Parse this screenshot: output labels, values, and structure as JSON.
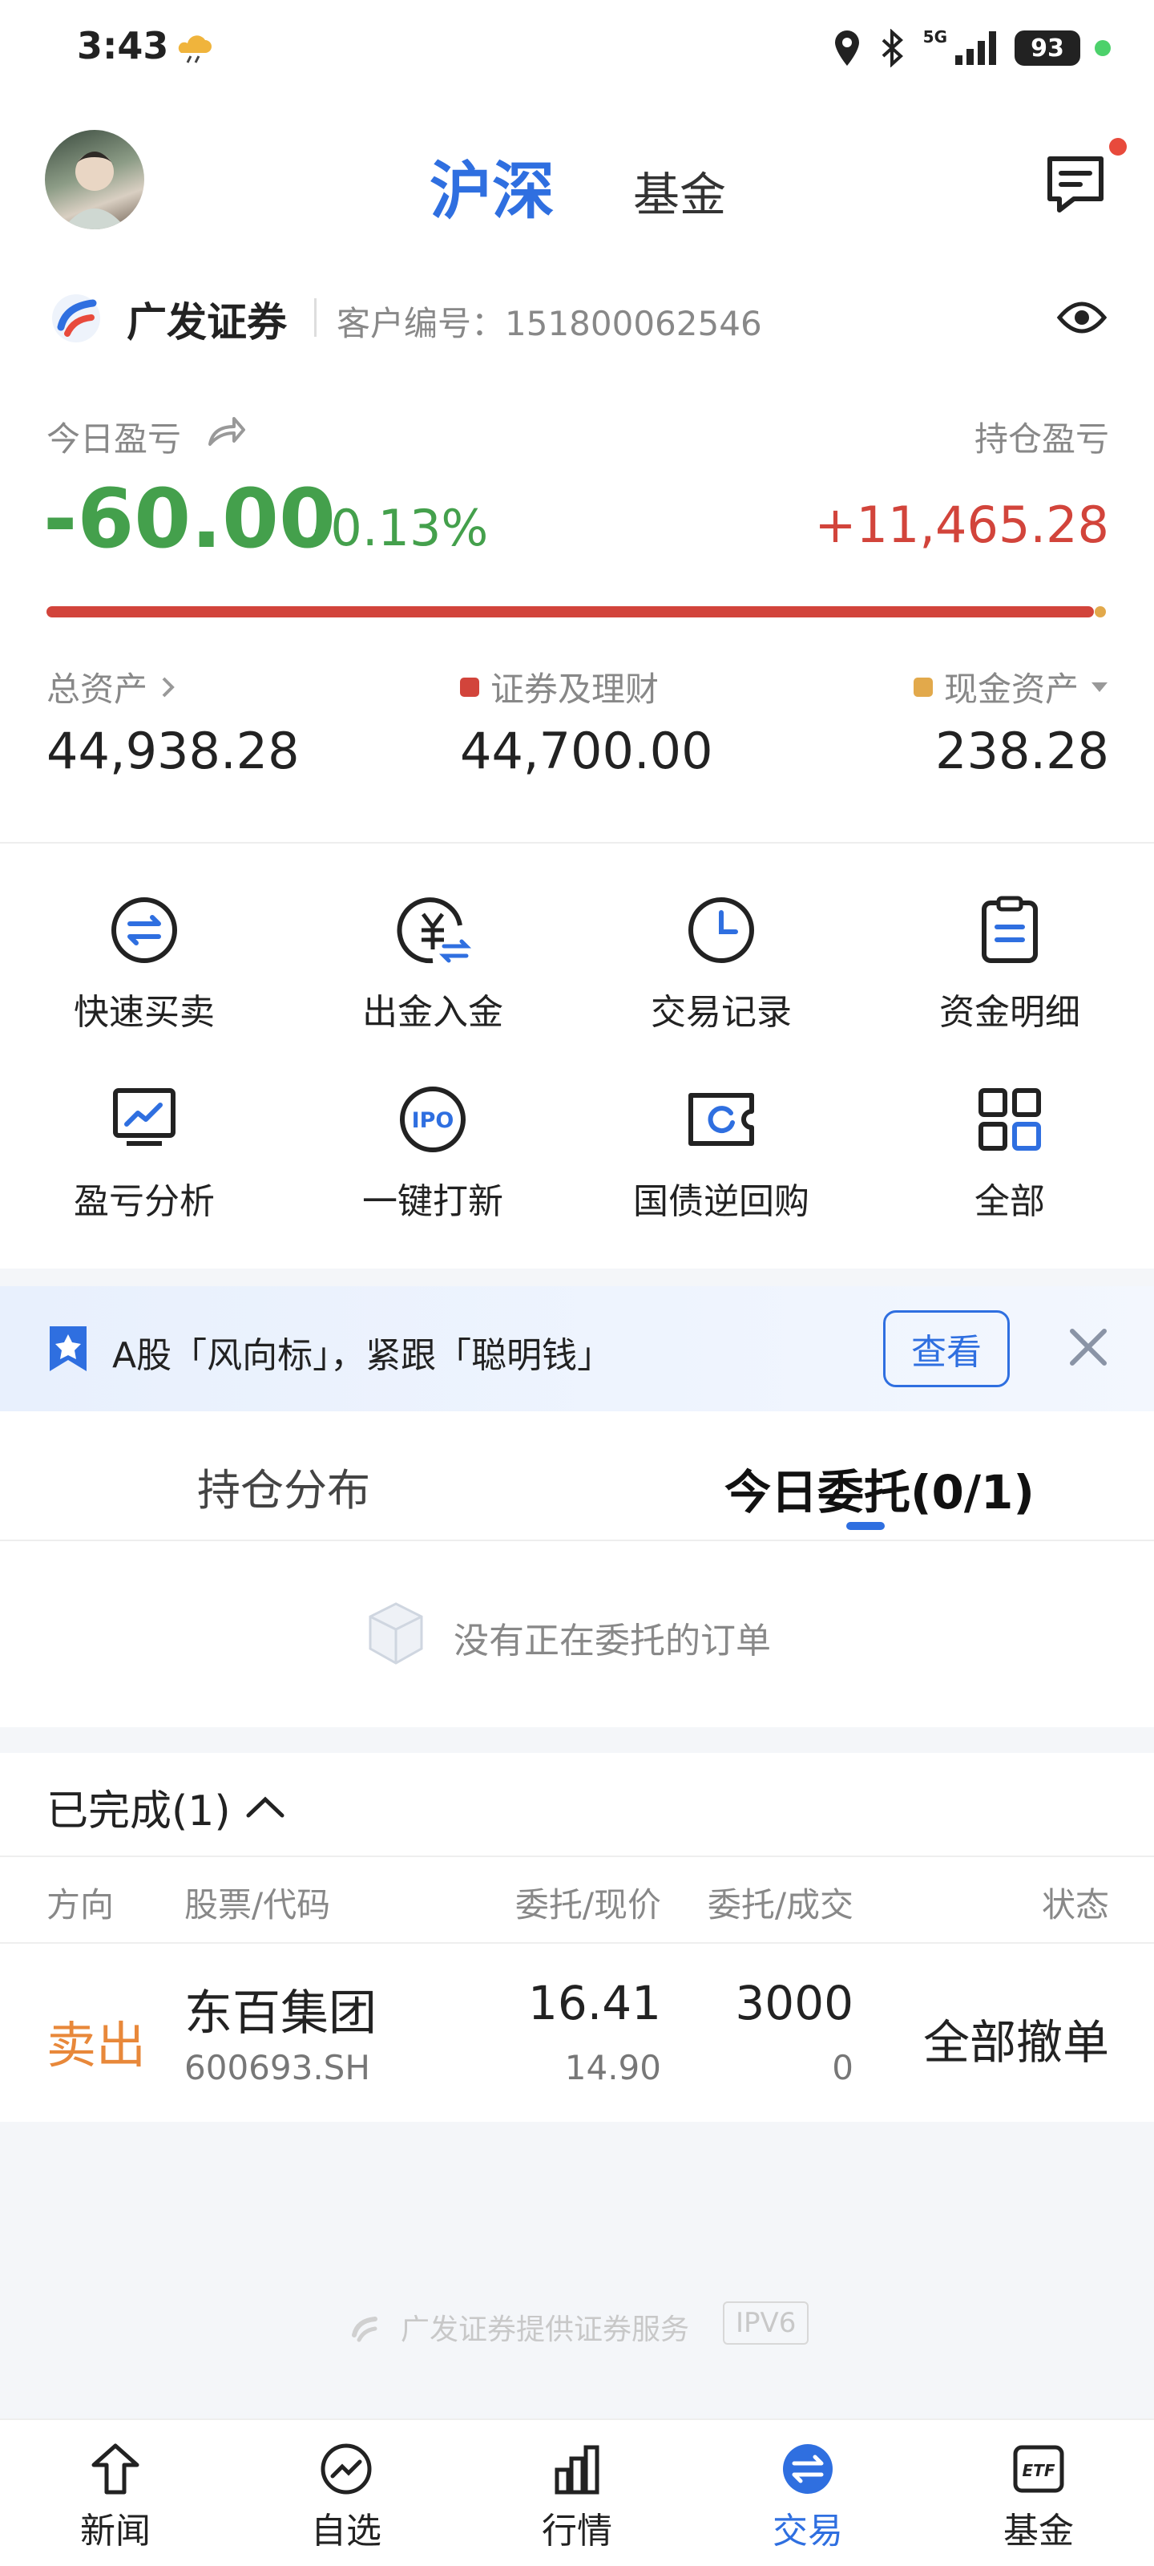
{
  "status_bar": {
    "time": "3:43",
    "network": "5G",
    "battery": "93"
  },
  "header": {
    "tab_main": "沪深",
    "tab_fund": "基金"
  },
  "account": {
    "broker": "广发证券",
    "client_label": "客户编号：151800062546"
  },
  "pnl": {
    "today_label": "今日盈亏",
    "today_value": "-60.00",
    "today_pct": "-0.13%",
    "hold_label": "持仓盈亏",
    "hold_value": "+11,465.28",
    "securities_share": 0.9947
  },
  "assets": {
    "total_label": "总资产",
    "total_value": "44,938.28",
    "securities_label": "证券及理财",
    "securities_value": "44,700.00",
    "cash_label": "现金资产",
    "cash_value": "238.28"
  },
  "colors": {
    "accent": "#2f6fe0",
    "gain": "#d2443b",
    "loss": "#44a04c",
    "cash": "#e2a94b",
    "sell": "#e8883a"
  },
  "quick_actions": [
    {
      "label": "快速买卖",
      "icon": "swap-icon"
    },
    {
      "label": "出金入金",
      "icon": "yuan-transfer-icon"
    },
    {
      "label": "交易记录",
      "icon": "clock-icon"
    },
    {
      "label": "资金明细",
      "icon": "clipboard-icon"
    },
    {
      "label": "盈亏分析",
      "icon": "chart-monitor-icon"
    },
    {
      "label": "一键打新",
      "icon": "ipo-icon"
    },
    {
      "label": "国债逆回购",
      "icon": "ticket-icon"
    },
    {
      "label": "全部",
      "icon": "grid-icon"
    }
  ],
  "banner": {
    "text": "A股「风向标」，紧跟「聪明钱」",
    "button": "查看"
  },
  "tabs": {
    "distribution": "持仓分布",
    "today_orders": "今日委托(0/1)"
  },
  "empty_state": {
    "text": "没有正在委托的订单"
  },
  "completed": {
    "title": "已完成(1)",
    "headers": [
      "方向",
      "股票/代码",
      "委托/现价",
      "委托/成交",
      "状态"
    ],
    "rows": [
      {
        "direction": "卖出",
        "name": "东百集团",
        "code": "600693.SH",
        "order_price": "16.41",
        "current_price": "14.90",
        "order_qty": "3000",
        "filled_qty": "0",
        "status": "全部撤单"
      }
    ]
  },
  "footer": {
    "text": "广发证券提供证券服务",
    "badge": "IPV6"
  },
  "bottom_nav": [
    {
      "label": "新闻",
      "icon": "news-icon"
    },
    {
      "label": "自选",
      "icon": "watchlist-icon"
    },
    {
      "label": "行情",
      "icon": "market-icon"
    },
    {
      "label": "交易",
      "icon": "trade-icon",
      "active": true
    },
    {
      "label": "基金",
      "icon": "etf-icon"
    }
  ]
}
